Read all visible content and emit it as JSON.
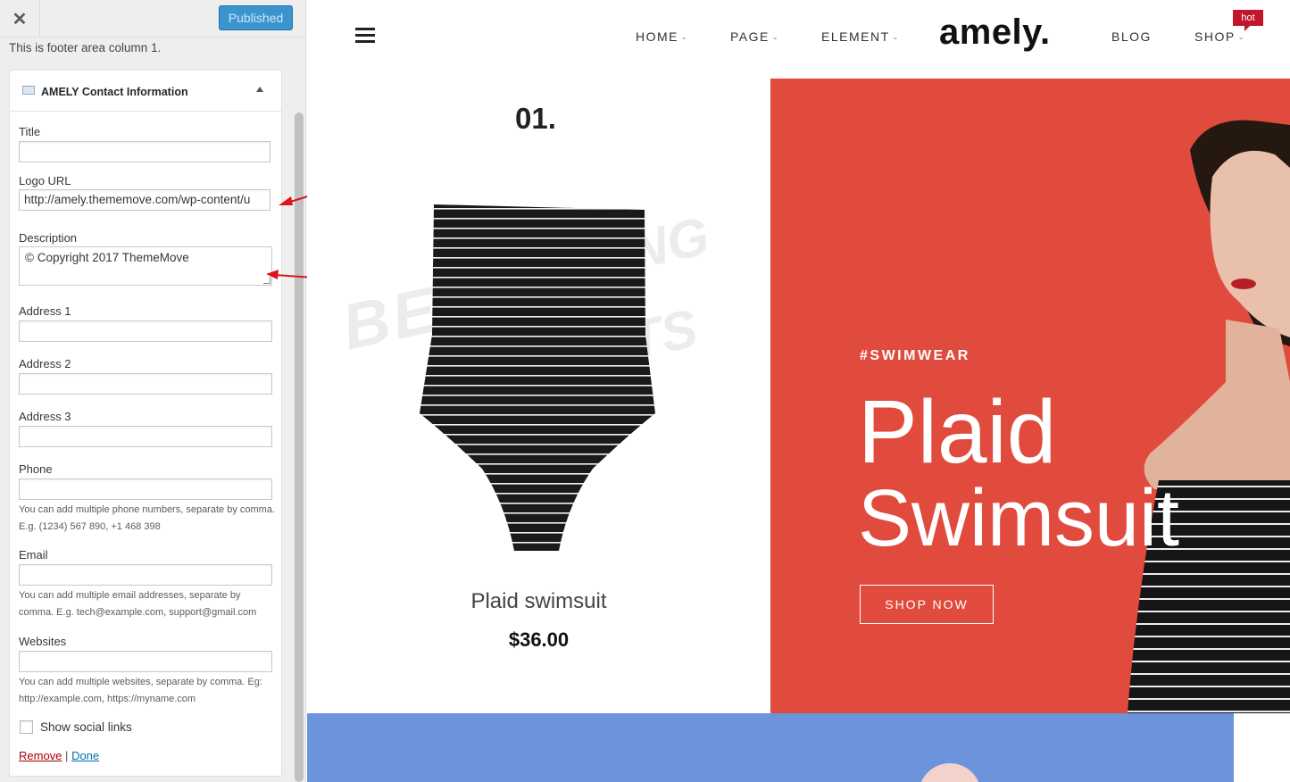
{
  "sidebar": {
    "close_icon": "close-icon",
    "published_label": "Published",
    "footer_note": "This is footer area column 1.",
    "widget": {
      "icon": "widget-image-icon",
      "title": "AMELY Contact Information",
      "fields": {
        "title_label": "Title",
        "title_value": "",
        "logo_label": "Logo URL",
        "logo_value": "http://amely.thememove.com/wp-content/u",
        "description_label": "Description",
        "description_value": "© Copyright 2017 ThemeMove",
        "address1_label": "Address 1",
        "address2_label": "Address 2",
        "address3_label": "Address 3",
        "phone_label": "Phone",
        "phone_help": "You can add multiple phone numbers, separate by comma. E.g. (1234) 567 890, +1 468 398",
        "email_label": "Email",
        "email_help": "You can add multiple email addresses, separate by comma. E.g. tech@example.com, support@gmail.com",
        "websites_label": "Websites",
        "websites_help": "You can add multiple websites, separate by comma. Eg: http://example.com, https://myname.com",
        "social_label": "Show social links",
        "social_checked": false
      },
      "remove_label": "Remove",
      "separator": "|",
      "done_label": "Done"
    }
  },
  "site": {
    "nav": {
      "home": "HOME",
      "page": "PAGE",
      "element": "ELEMENT",
      "blog": "BLOG",
      "shop": "SHOP",
      "hot_badge": "hot",
      "chevron": "⌄"
    },
    "logo": "amely.",
    "product": {
      "number": "01.",
      "name": "Plaid swimsuit",
      "price": "$36.00"
    },
    "hero": {
      "tag": "#SWIMWEAR",
      "title_line1": "Plaid",
      "title_line2": "Swimsuit",
      "button": "SHOP NOW",
      "background_color": "#e04b3d"
    },
    "band_color": "#6b94dc"
  }
}
